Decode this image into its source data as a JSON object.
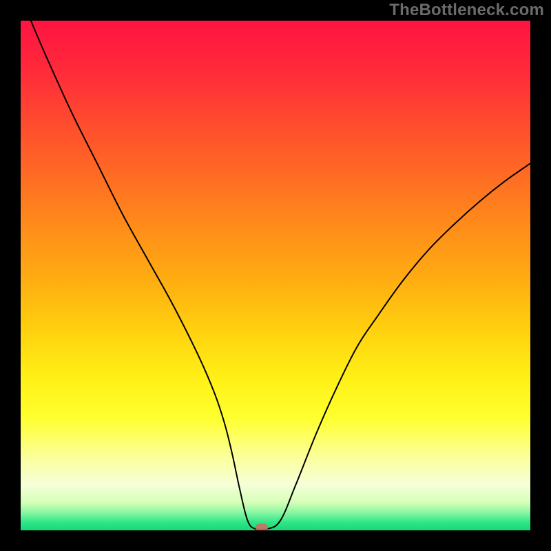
{
  "watermark": "TheBottleneck.com",
  "colors": {
    "frame": "#000000",
    "curve": "#000000",
    "marker": "#d46a5f"
  },
  "gradient_stops": [
    {
      "offset": 0.0,
      "color": "#ff1342"
    },
    {
      "offset": 0.1,
      "color": "#ff2b3a"
    },
    {
      "offset": 0.2,
      "color": "#ff4b2e"
    },
    {
      "offset": 0.3,
      "color": "#ff6a24"
    },
    {
      "offset": 0.4,
      "color": "#ff8b1a"
    },
    {
      "offset": 0.5,
      "color": "#ffaa12"
    },
    {
      "offset": 0.6,
      "color": "#ffce0e"
    },
    {
      "offset": 0.7,
      "color": "#fff016"
    },
    {
      "offset": 0.78,
      "color": "#ffff2f"
    },
    {
      "offset": 0.86,
      "color": "#fbffa0"
    },
    {
      "offset": 0.91,
      "color": "#f6ffd8"
    },
    {
      "offset": 0.945,
      "color": "#d6ffb8"
    },
    {
      "offset": 0.965,
      "color": "#88f7a2"
    },
    {
      "offset": 0.985,
      "color": "#2ee587"
    },
    {
      "offset": 1.0,
      "color": "#17d877"
    }
  ],
  "chart_data": {
    "type": "line",
    "title": "",
    "xlabel": "",
    "ylabel": "",
    "xlim": [
      0,
      100
    ],
    "ylim": [
      0,
      100
    ],
    "series": [
      {
        "name": "bottleneck-curve",
        "x": [
          2,
          5,
          10,
          15,
          20,
          25,
          30,
          35,
          38,
          40,
          41.5,
          43,
          44.5,
          46,
          48.5,
          51,
          54,
          58,
          62,
          66,
          70,
          75,
          80,
          85,
          90,
          95,
          100
        ],
        "y": [
          100,
          93,
          82,
          72,
          62,
          53,
          44,
          34,
          27,
          21,
          15,
          8,
          2,
          0.3,
          0.3,
          2,
          9,
          19,
          28,
          36,
          42,
          49,
          55,
          60,
          64.5,
          68.5,
          72
        ]
      }
    ],
    "flat_range": [
      44.5,
      48.5
    ],
    "marker": {
      "x": 47.3,
      "y": 0.5,
      "w": 2.4,
      "h": 1.6
    }
  }
}
